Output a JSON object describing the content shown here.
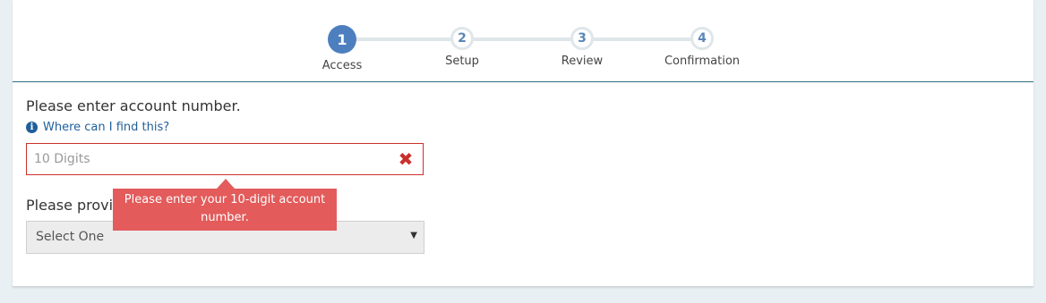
{
  "stepper": {
    "steps": [
      {
        "number": "1",
        "label": "Access",
        "state": "active"
      },
      {
        "number": "2",
        "label": "Setup",
        "state": "inactive"
      },
      {
        "number": "3",
        "label": "Review",
        "state": "inactive"
      },
      {
        "number": "4",
        "label": "Confirmation",
        "state": "inactive"
      }
    ]
  },
  "form": {
    "account_prompt": "Please enter account number.",
    "help_link": "Where can I find this?",
    "help_icon": "info-circle-icon",
    "account_input": {
      "value": "",
      "placeholder": "10 Digits"
    },
    "clear_icon": "times-icon",
    "error_tooltip": "Please enter your 10-digit account number.",
    "provide_prompt": "Please provide one of the following:",
    "select": {
      "selected": "Select One"
    }
  },
  "colors": {
    "accent": "#4d7fbf",
    "link": "#1f5f9a",
    "error": "#c9302c",
    "tooltip_bg": "#e35b5b",
    "page_bg": "#e8f0f3"
  }
}
